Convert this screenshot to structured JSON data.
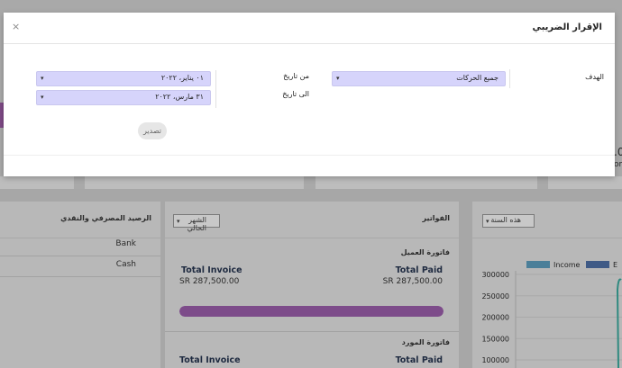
{
  "modal": {
    "title": "الإقرار الضريبي",
    "close_glyph": "×",
    "target_label": "الهدف",
    "target_value": "جميع الحركات",
    "from_label": "من تاريخ",
    "to_label": "الى تاريخ",
    "from_value": "٠١ يناير، ٢٠٢٢",
    "to_value": "٣١ مارس، ٢٠٢٢",
    "export_label": "تصدير"
  },
  "background": {
    "bank_panel": {
      "title": "الرصيد المصرفي والنقدي",
      "rows": [
        "Bank",
        "Cash"
      ]
    },
    "invoices_panel": {
      "title": "الفواتير",
      "period_select": "الشهر الحالي",
      "customer_section": "فاتورة العميل",
      "vendor_section": "فاتورة المورد",
      "total_invoice_label": "Total Invoice",
      "total_paid_label": "Total Paid",
      "customer_total_invoice": "SR 287,500.00",
      "customer_total_paid": "SR 287,500.00",
      "progress_fraction": 1.0,
      "progress_color": "#7d4c8a"
    },
    "chart_panel": {
      "period_select": "هذه السنة"
    },
    "right_partial_text": ".0",
    "right_partial_text2": "om"
  },
  "chart_data": {
    "type": "line",
    "series": [
      {
        "name": "Income",
        "color": "#4b7f99"
      },
      {
        "name": "E",
        "color": "#3f5a86"
      }
    ],
    "yticks": [
      "300000",
      "250000",
      "200000",
      "150000",
      "100000"
    ],
    "ylim": [
      100000,
      300000
    ]
  }
}
